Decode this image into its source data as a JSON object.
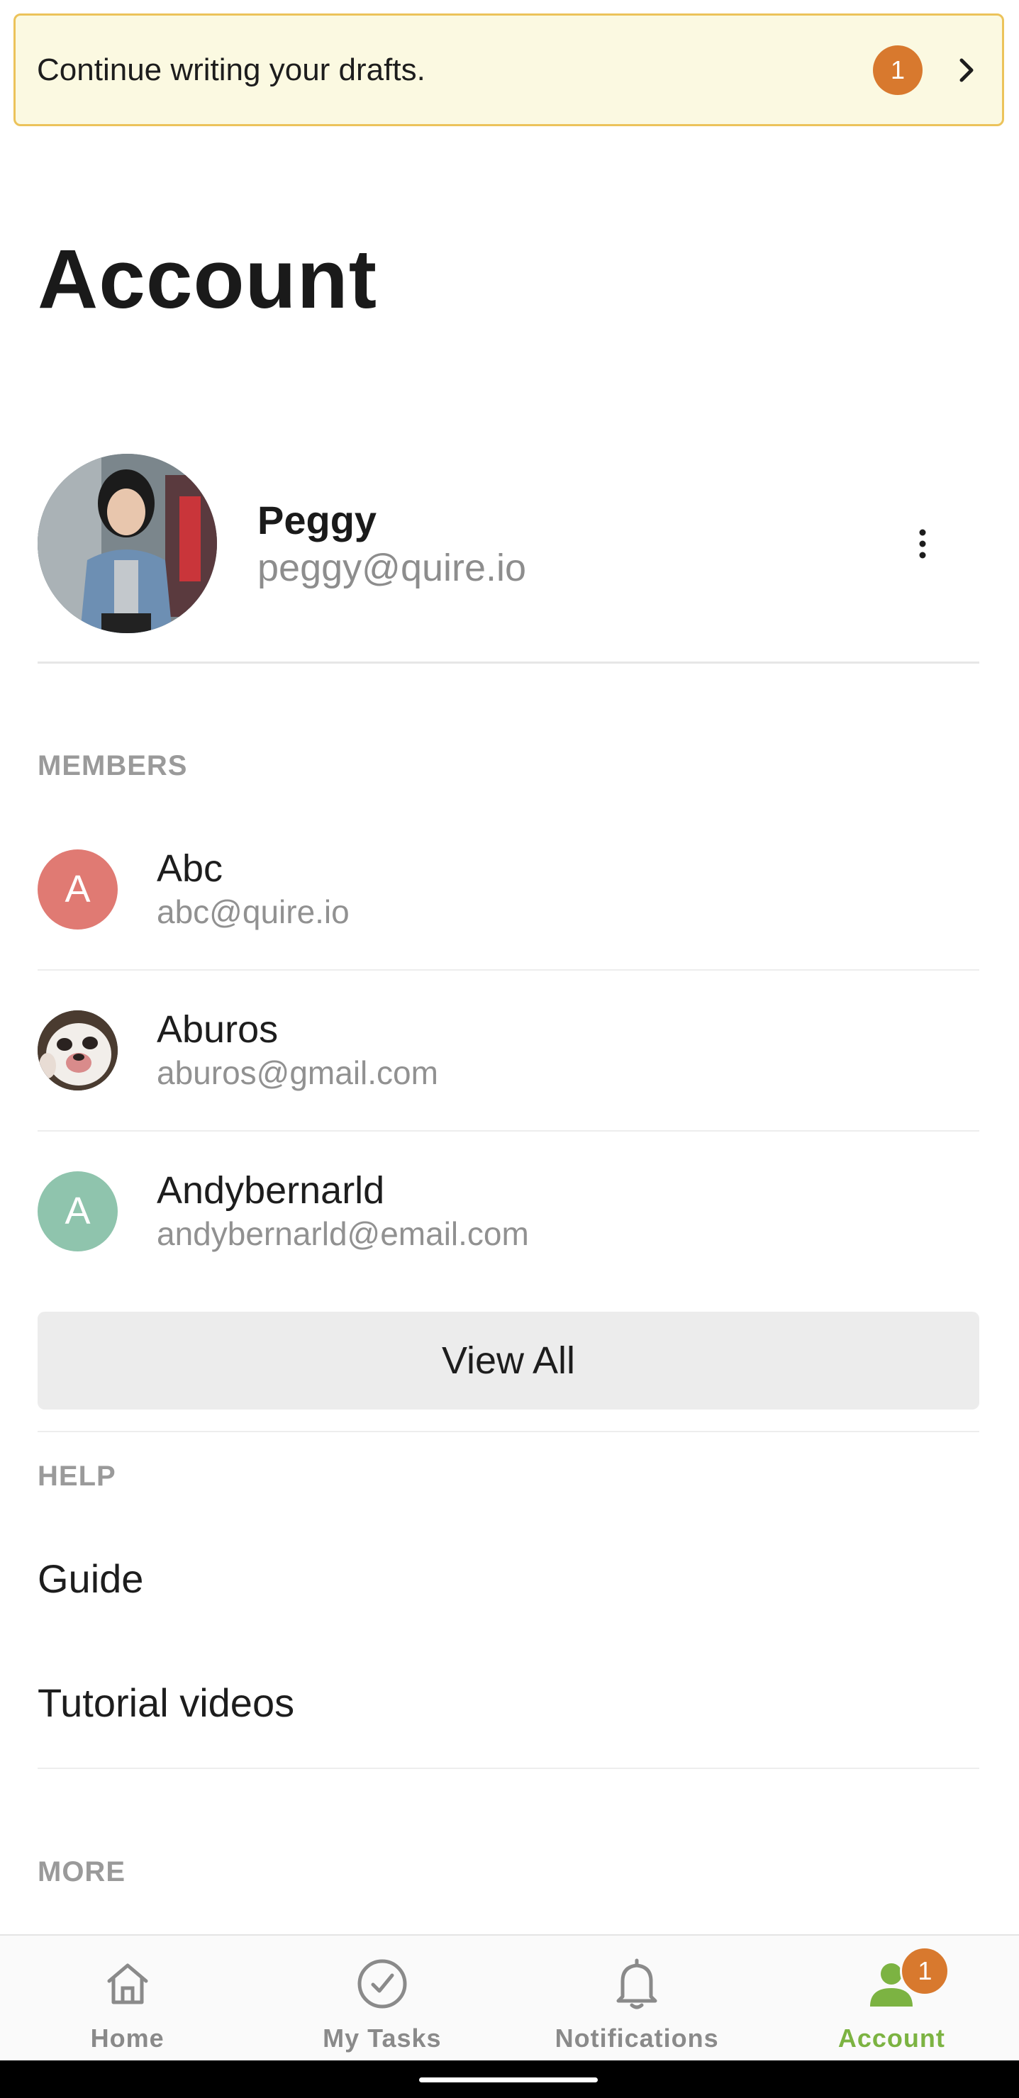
{
  "banner": {
    "text": "Continue writing your drafts.",
    "badge": "1",
    "icon": "chevron-right-icon"
  },
  "page": {
    "title": "Account"
  },
  "profile": {
    "name": "Peggy",
    "email": "peggy@quire.io",
    "menu_icon": "kebab-icon"
  },
  "members": {
    "header": "MEMBERS",
    "items": [
      {
        "initial": "A",
        "name": "Abc",
        "email": "abc@quire.io",
        "color": "#e07a73"
      },
      {
        "initial": "",
        "name": "Aburos",
        "email": "aburos@gmail.com",
        "color": "#3a3a3a"
      },
      {
        "initial": "A",
        "name": "Andybernarld",
        "email": "andybernarld@email.com",
        "color": "#8fc4ad"
      }
    ],
    "view_all_label": "View All"
  },
  "help": {
    "header": "HELP",
    "items": [
      {
        "label": "Guide"
      },
      {
        "label": "Tutorial videos"
      }
    ]
  },
  "more": {
    "header": "MORE"
  },
  "nav": {
    "items": [
      {
        "label": "Home",
        "icon": "home-icon",
        "active": false
      },
      {
        "label": "My Tasks",
        "icon": "check-circle-icon",
        "active": false
      },
      {
        "label": "Notifications",
        "icon": "bell-icon",
        "active": false
      },
      {
        "label": "Account",
        "icon": "person-icon",
        "active": true,
        "badge": "1"
      }
    ]
  },
  "colors": {
    "accent": "#7cb342",
    "badge": "#d8792e",
    "banner_bg": "#fbf9e1",
    "banner_border": "#ecc35a"
  }
}
